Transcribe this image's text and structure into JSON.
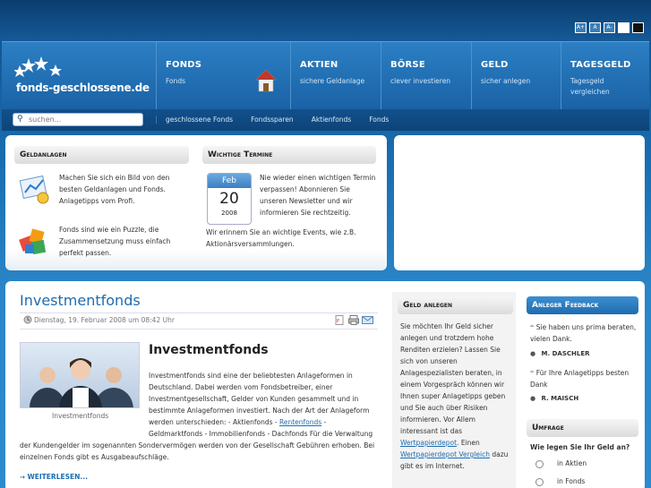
{
  "font_size_buttons": [
    "A+",
    "A",
    "A-"
  ],
  "logo": {
    "stars": "★ ★ ★\n  ★ ★",
    "text": "fonds-geschlossene.de"
  },
  "nav": [
    {
      "title": "FONDS",
      "subtitle": "Fonds"
    },
    {
      "title": "AKTIEN",
      "subtitle": "sichere Geldanlage"
    },
    {
      "title": "BÖRSE",
      "subtitle": "clever investieren"
    },
    {
      "title": "GELD",
      "subtitle": "sicher anlegen"
    },
    {
      "title": "TAGESGELD",
      "subtitle": "Tagesgeld vergleichen"
    }
  ],
  "search": {
    "placeholder": "suchen..."
  },
  "sublinks": [
    "geschlossene Fonds",
    "Fondssparen",
    "Aktienfonds",
    "Fonds"
  ],
  "geldanlagen": {
    "title": "Geldanlagen",
    "item1": "Machen Sie sich ein Bild von den besten Geldanlagen und Fonds. Anlagetipps vom Profi.",
    "item2": "Fonds sind wie ein Puzzle, die Zusammensetzung muss einfach perfekt passen."
  },
  "termine": {
    "title": "Wichtige Termine",
    "cal_month": "Feb",
    "cal_day": "20",
    "cal_year": "2008",
    "text": "Nie wieder einen wichtigen Termin verpassen! Abonnieren Sie unseren Newsletter und wir informieren Sie rechtzeitig.",
    "text2": "Wir erinnern Sie an wichtige Events, wie z.B. Aktionärsversammlungen."
  },
  "article": {
    "title": "Investmentfonds",
    "date": "Dienstag, 19. Februar 2008 um 08:42 Uhr",
    "heading": "Investmentfonds",
    "photo_caption": "Investmentfonds",
    "body_a": "Investmentfonds sind eine der beliebtesten Anlageformen in Deutschland. Dabei werden vom Fondsbetreiber, einer Investmentgesellschaft, Gelder von Kunden gesammelt und in bestimmte Anlageformen investiert. Nach der Art der Anlageform werden unterschieden: - Aktienfonds - ",
    "body_link": "Rentenfonds",
    "body_b": " - Geldmarktfonds - Immobilienfonds - Dachfonds Für die Verwaltung",
    "body_c": "der Kundengelder im sogenannten Sondervermögen werden von der Gesellschaft Gebühren erhoben. Bei einzelnen Fonds gibt es Ausgabeaufschläge.",
    "more": "WEITERLESEN..."
  },
  "geld_anlegen": {
    "title": "Geld anlegen",
    "text_a": "Sie möchten Ihr Geld sicher anlegen und trotzdem hohe Renditen erzielen? Lassen Sie sich von unseren Anlagespezialisten beraten, in einem Vorgespräch können wir Ihnen super Anlagetipps geben und Sie auch über Risiken informieren. Vor Allem interessant ist das ",
    "link1": "Wertpapierdepot",
    "text_b": ". Einen ",
    "link2": "Wertpapierdepot Vergleich",
    "text_c": " dazu gibt es im Internet."
  },
  "feedback": {
    "title": "Anleger Feedback",
    "q1": "Sie haben uns prima beraten, vielen Dank.",
    "a1": "M. DASCHLER",
    "q2": "Für Ihre Anlagetipps besten Dank",
    "a2": "R. MAISCH"
  },
  "poll": {
    "title": "Umfrage",
    "question": "Wie legen Sie Ihr Geld an?",
    "options": [
      "in Aktien",
      "in Fonds"
    ]
  }
}
